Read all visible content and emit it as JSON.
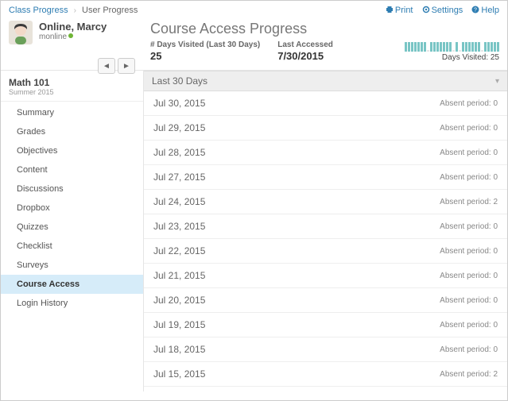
{
  "breadcrumb": {
    "root": "Class Progress",
    "current": "User Progress"
  },
  "toplinks": {
    "print": "Print",
    "settings": "Settings",
    "help": "Help"
  },
  "user": {
    "name": "Online, Marcy",
    "username": "monline"
  },
  "page_title": "Course Access Progress",
  "stats": {
    "days_label": "# Days Visited (Last 30 Days)",
    "days_value": "25",
    "last_label": "Last Accessed",
    "last_value": "7/30/2015"
  },
  "spark": {
    "pattern": [
      1,
      1,
      1,
      1,
      1,
      1,
      1,
      0,
      1,
      1,
      1,
      1,
      1,
      1,
      1,
      0,
      1,
      0,
      1,
      1,
      1,
      1,
      1,
      1,
      0,
      1,
      1,
      1,
      1,
      1
    ],
    "label": "Days Visited: 25"
  },
  "course": {
    "name": "Math 101",
    "term": "Summer 2015"
  },
  "sidebar": {
    "items": [
      {
        "label": "Summary"
      },
      {
        "label": "Grades"
      },
      {
        "label": "Objectives"
      },
      {
        "label": "Content"
      },
      {
        "label": "Discussions"
      },
      {
        "label": "Dropbox"
      },
      {
        "label": "Quizzes"
      },
      {
        "label": "Checklist"
      },
      {
        "label": "Surveys"
      },
      {
        "label": "Course Access",
        "active": true
      },
      {
        "label": "Login History"
      }
    ]
  },
  "section": {
    "title": "Last 30 Days"
  },
  "rows": [
    {
      "date": "Jul 30, 2015",
      "meta": "Absent period: 0"
    },
    {
      "date": "Jul 29, 2015",
      "meta": "Absent period: 0"
    },
    {
      "date": "Jul 28, 2015",
      "meta": "Absent period: 0"
    },
    {
      "date": "Jul 27, 2015",
      "meta": "Absent period: 0"
    },
    {
      "date": "Jul 24, 2015",
      "meta": "Absent period: 2"
    },
    {
      "date": "Jul 23, 2015",
      "meta": "Absent period: 0"
    },
    {
      "date": "Jul 22, 2015",
      "meta": "Absent period: 0"
    },
    {
      "date": "Jul 21, 2015",
      "meta": "Absent period: 0"
    },
    {
      "date": "Jul 20, 2015",
      "meta": "Absent period: 0"
    },
    {
      "date": "Jul 19, 2015",
      "meta": "Absent period: 0"
    },
    {
      "date": "Jul 18, 2015",
      "meta": "Absent period: 0"
    },
    {
      "date": "Jul 15, 2015",
      "meta": "Absent period: 2"
    }
  ]
}
